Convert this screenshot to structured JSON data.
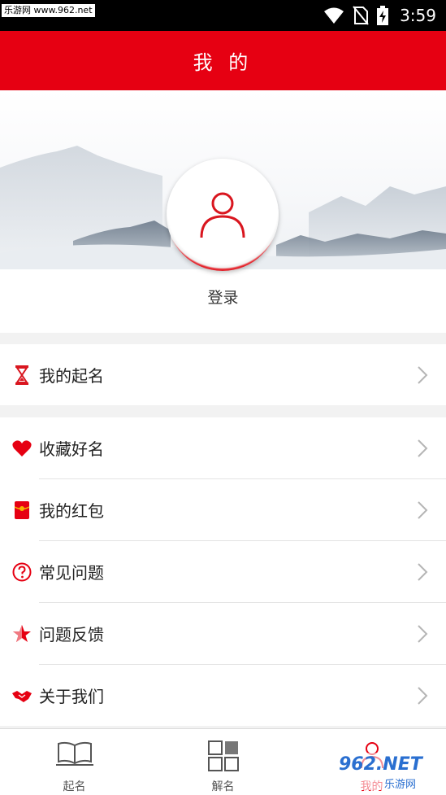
{
  "status_bar": {
    "watermark": "乐游网 www.962.net",
    "time": "3:59",
    "icons": [
      "wifi-icon",
      "no-sim-icon",
      "battery-charging-icon"
    ]
  },
  "header": {
    "title": "我 的"
  },
  "profile": {
    "login_label": "登录",
    "avatar_icon": "user-icon"
  },
  "menu_group_1": [
    {
      "label": "我的起名",
      "icon": "hourglass-icon"
    }
  ],
  "menu_group_2": [
    {
      "label": "收藏好名",
      "icon": "heart-icon"
    },
    {
      "label": "我的红包",
      "icon": "red-envelope-icon"
    },
    {
      "label": "常见问题",
      "icon": "question-icon"
    },
    {
      "label": "问题反馈",
      "icon": "star-icon"
    },
    {
      "label": "关于我们",
      "icon": "handshake-icon"
    }
  ],
  "tabbar": {
    "tabs": [
      {
        "label": "起名",
        "icon": "book-icon"
      },
      {
        "label": "解名",
        "icon": "grid-icon"
      },
      {
        "label": "我的",
        "icon": "user-icon"
      }
    ]
  },
  "watermark_br": {
    "text": "962.NET",
    "subtext": "乐游网"
  },
  "colors": {
    "brand_red": "#e60012",
    "text": "#222222",
    "chevron": "#b5b5b5"
  }
}
